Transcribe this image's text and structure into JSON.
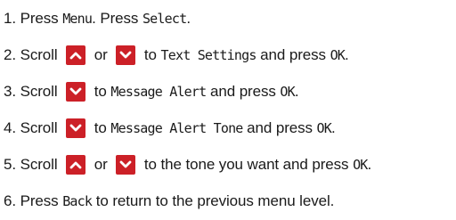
{
  "colors": {
    "text": "#1a1a1a",
    "key_background": "#cc2027",
    "key_arrow": "#ffffff"
  },
  "steps": [
    {
      "segments": [
        {
          "kind": "text",
          "text": "1. Press "
        },
        {
          "kind": "lcd",
          "text": "Menu"
        },
        {
          "kind": "text",
          "text": ". Press "
        },
        {
          "kind": "lcd",
          "text": "Select"
        },
        {
          "kind": "text",
          "text": "."
        }
      ]
    },
    {
      "segments": [
        {
          "kind": "text",
          "text": "2. Scroll "
        },
        {
          "kind": "icon",
          "icon": "up-arrow-key-icon"
        },
        {
          "kind": "text",
          "text": " or "
        },
        {
          "kind": "icon",
          "icon": "down-arrow-key-icon"
        },
        {
          "kind": "text",
          "text": " to "
        },
        {
          "kind": "lcd",
          "text": "Text Settings"
        },
        {
          "kind": "text",
          "text": " and press "
        },
        {
          "kind": "lcd",
          "text": "OK"
        },
        {
          "kind": "text",
          "text": "."
        }
      ]
    },
    {
      "segments": [
        {
          "kind": "text",
          "text": "3. Scroll "
        },
        {
          "kind": "icon",
          "icon": "down-arrow-key-icon"
        },
        {
          "kind": "text",
          "text": " to "
        },
        {
          "kind": "lcd",
          "text": "Message Alert"
        },
        {
          "kind": "text",
          "text": " and press "
        },
        {
          "kind": "lcd",
          "text": "OK"
        },
        {
          "kind": "text",
          "text": "."
        }
      ]
    },
    {
      "segments": [
        {
          "kind": "text",
          "text": "4. Scroll "
        },
        {
          "kind": "icon",
          "icon": "down-arrow-key-icon"
        },
        {
          "kind": "text",
          "text": " to "
        },
        {
          "kind": "lcd",
          "text": "Message Alert Tone"
        },
        {
          "kind": "text",
          "text": " and press "
        },
        {
          "kind": "lcd",
          "text": "OK"
        },
        {
          "kind": "text",
          "text": "."
        }
      ]
    },
    {
      "segments": [
        {
          "kind": "text",
          "text": "5. Scroll "
        },
        {
          "kind": "icon",
          "icon": "up-arrow-key-icon"
        },
        {
          "kind": "text",
          "text": " or "
        },
        {
          "kind": "icon",
          "icon": "down-arrow-key-icon"
        },
        {
          "kind": "text",
          "text": " to the tone you want and press "
        },
        {
          "kind": "lcd",
          "text": "OK"
        },
        {
          "kind": "text",
          "text": "."
        }
      ]
    },
    {
      "segments": [
        {
          "kind": "text",
          "text": "6. Press "
        },
        {
          "kind": "lcd",
          "text": "Back"
        },
        {
          "kind": "text",
          "text": " to return to the previous menu level."
        }
      ]
    }
  ]
}
